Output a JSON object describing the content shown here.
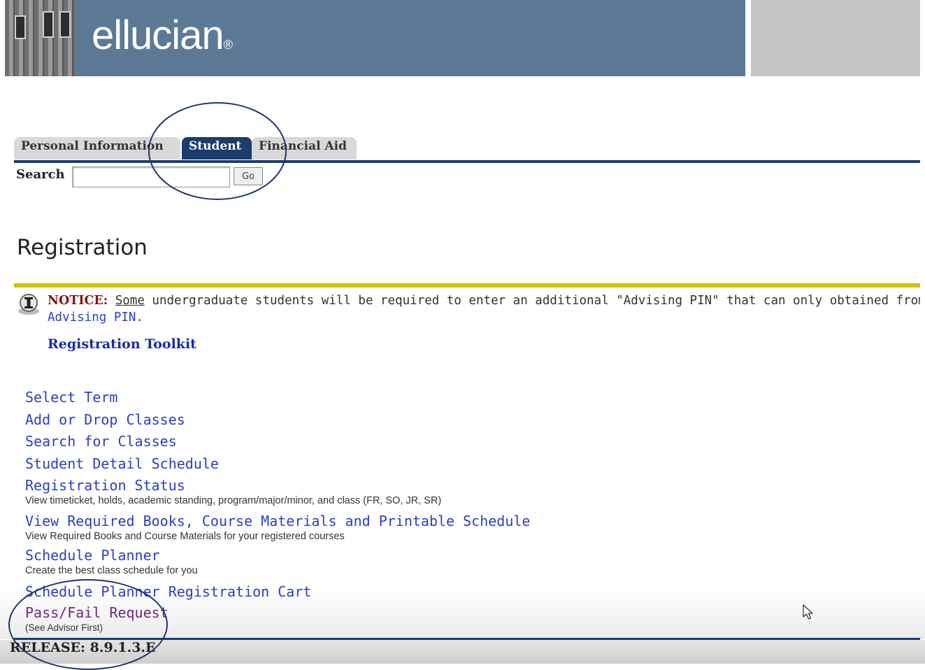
{
  "header": {
    "brand": "ellucian",
    "brand_mark": "®"
  },
  "tabs": [
    {
      "label": "Personal Information",
      "active": false
    },
    {
      "label": "Student",
      "active": true
    },
    {
      "label": "Financial Aid",
      "active": false
    }
  ],
  "search": {
    "label": "Search",
    "value": "",
    "go_label": "Go"
  },
  "page": {
    "title": "Registration"
  },
  "notice": {
    "label": "NOTICE:",
    "underlined": "Some",
    "text": " undergraduate students will be required to enter an additional \"Advising PIN\" that can only obtained from their a",
    "link": "Advising PIN."
  },
  "toolkit": {
    "label": "Registration Toolkit"
  },
  "menu": {
    "items": [
      {
        "label": "Select Term"
      },
      {
        "label": "Add or Drop Classes"
      },
      {
        "label": "Search for Classes"
      },
      {
        "label": "Student Detail Schedule"
      },
      {
        "label": "Registration Status",
        "desc": "View timeticket, holds, academic standing, program/major/minor, and class (FR, SO, JR, SR)"
      },
      {
        "label": "View Required Books, Course Materials and Printable Schedule",
        "desc": "View Required Books and Course Materials for your registered courses"
      },
      {
        "label": "Schedule Planner",
        "desc": "Create the best class schedule for you"
      },
      {
        "label": "Schedule Planner Registration Cart"
      },
      {
        "label": "Pass/Fail Request",
        "desc": "(See Advisor First)"
      }
    ]
  },
  "footer": {
    "release": "RELEASE: 8.9.1.3.E"
  },
  "colors": {
    "banner": "#5c7a95",
    "tab_active": "#1c3d6c",
    "link": "#2a3fc4",
    "notice_label": "#8b1010",
    "rule_yellow": "#d3c500"
  }
}
